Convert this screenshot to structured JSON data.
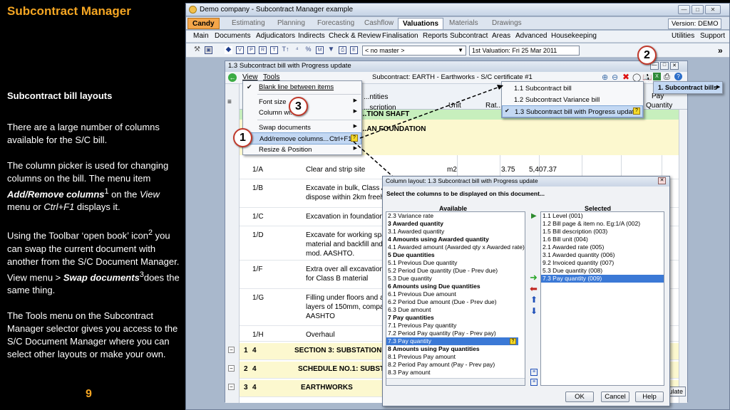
{
  "slide": {
    "title": "Subcontract Manager",
    "heading": "Subcontract bill layouts",
    "p1": "There are a large number of columns available for the S/C bill.",
    "p2_a": "The column picker is used for changing columns on the bill.  The menu item ",
    "p2_b": "Add/Remove columns",
    "p2_sup": "1",
    "p2_c": " on the ",
    "p2_d": "View",
    "p2_e": " menu or ",
    "p2_f": "Ctrl+F1",
    "p2_g": " displays it.",
    "p3_a": "Using the Toolbar ‘open book’ icon",
    "p3_sup": "2",
    "p3_b": " you can swap the current document with another from the S/C Document Manager.  View menu > ",
    "p3_c": "Swap documents",
    "p3_sup2": "3",
    "p3_d": "does the same thing.",
    "p4": "The Tools menu on the Subcontract Manager selector gives you access to the S/C Document Manager where you can select other layouts or make your own.",
    "page_number": "9"
  },
  "app": {
    "window_title": "Demo company - Subcontract Manager example",
    "tabs": [
      "Candy",
      "Estimating",
      "Planning",
      "Forecasting",
      "Cashflow",
      "Valuations",
      "Materials",
      "Drawings"
    ],
    "version": "Version: DEMO",
    "menu": [
      "Main",
      "Documents",
      "Adjudicators",
      "Indirects",
      "Check & Review",
      "Finalisation",
      "Reports",
      "Subcontract",
      "Areas",
      "Advanced",
      "Housekeeping"
    ],
    "menu_right": [
      "Utilities",
      "Support"
    ],
    "master_select": "< no master >",
    "valuation_label": "1st Valuation: Fri 25 Mar 2011"
  },
  "doc": {
    "title": "1.3 Subcontract bill with Progress update",
    "menu_view": "View",
    "menu_tools": "Tools",
    "subcontract_label": "Subcontract: EARTH - Earthworks - S/C certificate #1",
    "col_headers": [
      "...ntities",
      "...scription",
      "Unit",
      "Rat...",
      "Pay",
      "Quantity"
    ],
    "rows": [
      {
        "ref": "",
        "desc": "...TION SHAFT",
        "unit": "",
        "rate": "",
        "amt": ""
      },
      {
        "ref": "",
        "desc": "...AN FOUNDATION",
        "unit": "",
        "rate": "",
        "amt": ""
      },
      {
        "ref": "1/A",
        "desc": "Clear and strip site",
        "unit": "m2",
        "rate": "3.75",
        "amt": "5,407.37"
      },
      {
        "ref": "1/B",
        "desc": "Excavate in bulk, Class A",
        "desc2": "dispose within 2km freeha",
        "unit": "",
        "rate": "",
        "amt": ""
      },
      {
        "ref": "1/C",
        "desc": "Excavation in foundations",
        "unit": "",
        "rate": "",
        "amt": ""
      },
      {
        "ref": "1/D",
        "desc": "Excavate for working spac",
        "desc2": "material and backfill and c",
        "desc3": "mod. AASHTO.",
        "unit": "",
        "rate": "",
        "amt": ""
      },
      {
        "ref": "1/F",
        "desc": "Extra over all excavations",
        "desc2": "for Class B material",
        "unit": "",
        "rate": "",
        "amt": ""
      },
      {
        "ref": "1/G",
        "desc": "Filling under floors and ar",
        "desc2": "layers of 150mm, compac",
        "desc3": "AASHTO",
        "unit": "",
        "rate": "",
        "amt": ""
      },
      {
        "ref": "1/H",
        "desc": "Overhaul",
        "unit": "",
        "rate": "",
        "amt": ""
      }
    ],
    "sections": [
      {
        "lvl": "1",
        "num": "4",
        "text": "SECTION 3: SUBSTATION A"
      },
      {
        "lvl": "2",
        "num": "4",
        "text": "SCHEDULE NO.1: SUBSTA"
      },
      {
        "lvl": "3",
        "num": "4",
        "text": "EARTHWORKS"
      }
    ],
    "calc_btn": "...ulate"
  },
  "view_menu": {
    "items": [
      "Blank line between items",
      "Font size",
      "Column wi...",
      "Swap documents",
      "Add/remove columns...",
      "Resize & Position"
    ],
    "shortcut": "Ctrl+F1"
  },
  "swap_menu": {
    "items": [
      "1.1 Subcontract bill",
      "1.2 Subcontract Variance bill",
      "1.3 Subcontract bill with Progress update"
    ],
    "bills_label": "1. Subcontract bills"
  },
  "dialog": {
    "title": "Column layout: 1.3 Subcontract bill with Progress update",
    "instruction": "Select the columns to be displayed on this document...",
    "available_label": "Available",
    "selected_label": "Selected",
    "available": [
      {
        "t": "2.3  Variance rate",
        "b": false
      },
      {
        "t": "3 Awarded quantity",
        "b": true
      },
      {
        "t": "3.1  Awarded quantity",
        "b": false
      },
      {
        "t": "4 Amounts using Awarded quantity",
        "b": true
      },
      {
        "t": "4.1  Awarded amount (Awarded qty x Awarded rate)",
        "b": false
      },
      {
        "t": "5 Due quantities",
        "b": true
      },
      {
        "t": "5.1  Previous Due quantity",
        "b": false
      },
      {
        "t": "5.2  Period Due quantity (Due - Prev due)",
        "b": false
      },
      {
        "t": "5.3  Due quantity",
        "b": false
      },
      {
        "t": "6 Amounts using Due quantities",
        "b": true
      },
      {
        "t": "6.1  Previous Due amount",
        "b": false
      },
      {
        "t": "6.2  Period Due amount (Due - Prev due)",
        "b": false
      },
      {
        "t": "6.3  Due amount",
        "b": false
      },
      {
        "t": "7 Pay quantities",
        "b": true
      },
      {
        "t": "7.1  Previous Pay quantity",
        "b": false
      },
      {
        "t": "7.2  Period Pay quantity (Pay - Prev pay)",
        "b": false
      },
      {
        "t": "7.3  Pay quantity",
        "b": false,
        "sel": true
      },
      {
        "t": "8 Amounts using Pay quantities",
        "b": true
      },
      {
        "t": "8.1  Previous Pay amount",
        "b": false
      },
      {
        "t": "8.2  Period Pay amount (Pay - Prev pay)",
        "b": false
      },
      {
        "t": "8.3  Pay amount",
        "b": false
      }
    ],
    "selected": [
      {
        "t": "1.1   Level (001)"
      },
      {
        "t": "1.2   Bill page & item no. Eg:1/A (002)"
      },
      {
        "t": "1.5   Bill description (003)"
      },
      {
        "t": "1.6   Bill unit (004)"
      },
      {
        "t": "2.1   Awarded rate (005)"
      },
      {
        "t": "3.1   Awarded quantity (006)"
      },
      {
        "t": "9.2   Invoiced quantity (007)"
      },
      {
        "t": "5.3   Due quantity (008)"
      },
      {
        "t": "7.3   Pay quantity (009)",
        "sel": true
      }
    ],
    "ok": "OK",
    "cancel": "Cancel",
    "help": "Help"
  },
  "callouts": [
    "1",
    "2",
    "3"
  ]
}
